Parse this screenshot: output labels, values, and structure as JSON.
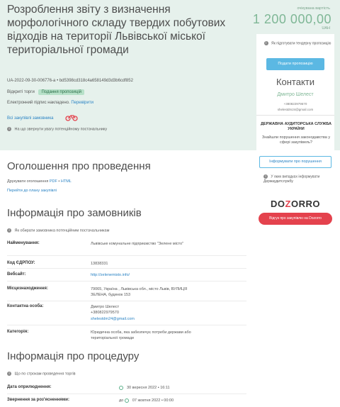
{
  "header": {
    "title": "Розроблення звіту з визначення морфологічного складу твердих побутових відходів на території Львівської міської територіальної громади",
    "tender_id": "UA-2022-09-30-006776-a",
    "tender_hash": "bd5398cd318c4a658149d3d3b6cdf852",
    "procurement_type": "Відкриті торги",
    "status": "Подання пропозицій",
    "signature_text": "Електронний підпис накладено.",
    "signature_link": "Перевірити",
    "buyer_link": "Всі закупівлі замовника",
    "notice_text": "На що звернути увагу потенційному постачальнику",
    "expected_label": "очікувана вартість",
    "expected_value": "1 200 000,00",
    "currency": "UAH"
  },
  "sidebar": {
    "hint": "Як підготувати тендерну пропозицію",
    "submit_button": "Подати пропозицію",
    "contacts_title": "Контакти",
    "contact_name": "Дмитро Шелест",
    "contact_phone": "+380822979570",
    "contact_email": "shelestdm24@gmail.com",
    "audit_title": "ДЕРЖАВНА АУДИТОРСЬКА СЛУЖБА УКРАЇНИ",
    "audit_question": "Знайшли порушення законодавства у сфері закупівель?",
    "audit_button": "Інформувати про порушення",
    "audit_note": "У яких випадках інформувати Держаудитслужбу",
    "dozorro_left": "DO",
    "dozorro_mid": "Z",
    "dozorro_right": "ORRO",
    "dozorro_button": "Відгук про закупівлю на Dozorro"
  },
  "announcement": {
    "title": "Оголошення про проведення",
    "print_label": "Друкувати оголошення",
    "print_pdf": "PDF",
    "print_html": "HTML",
    "plan_link": "Перейти до плану закупівлі"
  },
  "customer": {
    "title": "Інформація про замовників",
    "hint": "Як обирати замовника потенційним постачальникам",
    "rows": [
      {
        "label": "Найменування:",
        "value": "Львівське комунальне підприємство \"Зелене місто\""
      },
      {
        "label": "Код ЄДРПОУ:",
        "value": "13838331"
      },
      {
        "label": "Вебсайт:",
        "value": "http://zelenemisto.info/"
      },
      {
        "label": "Місцезнаходження:",
        "value": "79065, Україна , Львівська обл., місто Львів, ВУЛИЦЯ ЗЕЛЕНА, будинок 153"
      },
      {
        "label": "Контактна особа:",
        "value": "Дмитро Шелест"
      },
      {
        "label": "Категорія:",
        "value": "Юридична особа, яка забезпечує потреби держави або територіальної громади"
      }
    ],
    "contact_phone": "+380822979570",
    "contact_email": "shelestdm24@gmail.com"
  },
  "procedure": {
    "title": "Інформація про процедуру",
    "hint": "Що по строкам проведення торгів",
    "rows": [
      {
        "label": "Дата оприлюднення:",
        "value": "30 вересня 2022  •  16:11"
      },
      {
        "label": "Звернення за роз'ясненнями:",
        "prefix": "до",
        "value": "07 жовтня 2022  •  00:00"
      }
    ]
  },
  "colors": {
    "header_bg": "#e6f1ec",
    "accent_green": "#7fb796",
    "link_blue": "#2a83c4",
    "button_blue": "#5bb8e3",
    "dozorro_red": "#e4424d"
  }
}
